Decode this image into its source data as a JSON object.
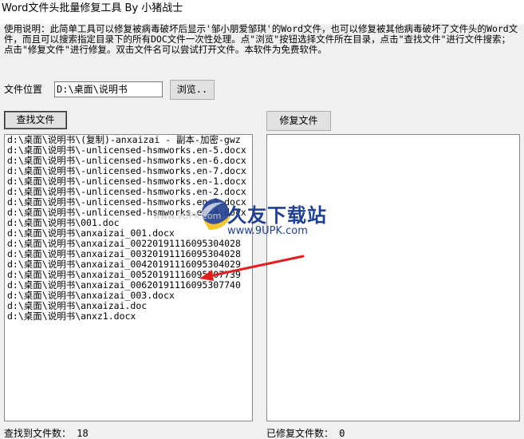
{
  "window": {
    "title": "Word文件头批量修复工具  By 小猪战士"
  },
  "description": "使用说明：此简单工具可以修复被病毒破坏后显示'邹小朋爱邹琪'的Word文件，也可以修复被其他病毒破坏了文件头的Word文件，而且可以搜索指定目录下的所有DOC文件一次性处理。点\"浏览\"按钮选择文件所在目录，点击\"查找文件\"进行文件搜索；点击\"修复文件\"进行修复。双击文件名可以尝试打开文件。本软件为免费软件。",
  "location": {
    "label": "文件位置",
    "value": "D:\\桌面\\说明书",
    "browse_button": "浏览.."
  },
  "find_button": "查找文件",
  "repair_button": "修复文件",
  "found_files": [
    "d:\\桌面\\说明书\\(复制)-anxaizai - 副本-加密-gwz",
    "d:\\桌面\\说明书\\-unlicensed-hsmworks.en-5.docx",
    "d:\\桌面\\说明书\\-unlicensed-hsmworks.en-6.docx",
    "d:\\桌面\\说明书\\-unlicensed-hsmworks.en-7.docx",
    "d:\\桌面\\说明书\\-unlicensed-hsmworks.en-1.docx",
    "d:\\桌面\\说明书\\-unlicensed-hsmworks.en-2.docx",
    "d:\\桌面\\说明书\\-unlicensed-hsmworks.en-3.docx",
    "d:\\桌面\\说明书\\-unlicensed-hsmworks.en-4.docx",
    "d:\\桌面\\说明书\\001.doc",
    "d:\\桌面\\说明书\\anxaizai_001.docx",
    "d:\\桌面\\说明书\\anxaizai_00220191116095304028",
    "d:\\桌面\\说明书\\anxaizai_00320191116095304028",
    "d:\\桌面\\说明书\\anxaizai_00420191116095304029",
    "d:\\桌面\\说明书\\anxaizai_00520191116095307739",
    "d:\\桌面\\说明书\\anxaizai_00620191116095307740",
    "d:\\桌面\\说明书\\anxaizai_003.docx",
    "d:\\桌面\\说明书\\anxaizai.doc",
    "d:\\桌面\\说明书\\anxz1.docx"
  ],
  "repaired_files": [],
  "status": {
    "found": "查找到文件数：  18",
    "repaired": "已修复文件数：  0"
  },
  "watermark": {
    "brand": "久友下载站",
    "url": "www.9UPK.com",
    "side": "www.9UPK.com"
  },
  "colors": {
    "arrow": "#e02020",
    "watermark_blue": "#1f3f8f",
    "watermark_yellow": "#f3c21a"
  }
}
